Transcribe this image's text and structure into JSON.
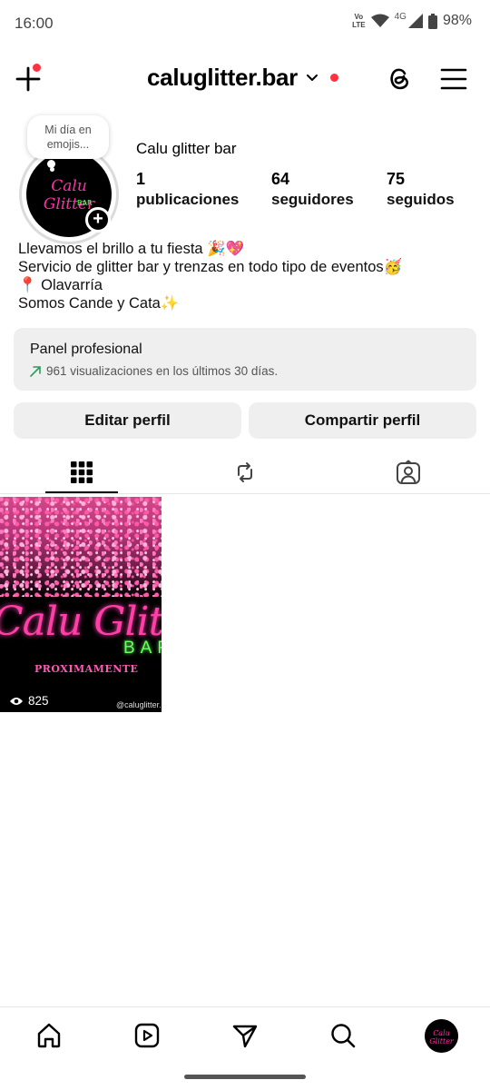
{
  "status_bar": {
    "time": "16:00",
    "volte_top": "Vo",
    "volte_bottom": "LTE",
    "network": "4G",
    "battery": "98%"
  },
  "header": {
    "username": "caluglitter.bar",
    "icons": [
      "plus-icon",
      "chevron-down-icon",
      "threads-icon",
      "menu-icon"
    ],
    "notification_color": "#ff3040"
  },
  "profile": {
    "note": "Mi día en emojis...",
    "avatar_logo_text": "Calu Glitter",
    "avatar_logo_sub": "BAR",
    "display_name": "Calu glitter bar",
    "stats": {
      "posts_count": "1",
      "posts_label": "publicaciones",
      "followers_count": "64",
      "followers_label": "seguidores",
      "following_count": "75",
      "following_label": "seguidos"
    },
    "bio": [
      "Llevamos el brillo a tu fiesta 🎉💖",
      "Servicio de glitter bar y trenzas en todo tipo de eventos🥳",
      "📍 Olavarría",
      "Somos Cande y Cata✨"
    ]
  },
  "panel": {
    "title": "Panel profesional",
    "subtitle": "961 visualizaciones en los últimos 30 días.",
    "accent": "#2e9b5e"
  },
  "buttons": {
    "edit": "Editar perfil",
    "share": "Compartir perfil"
  },
  "tabs": [
    "grid-icon",
    "reposts-icon",
    "tagged-icon"
  ],
  "post": {
    "title": "Calu Glitter",
    "bar": "BAR",
    "subtitle": "PROXIMAMENTE",
    "views": "825",
    "handle": "@caluglitter."
  },
  "bottom_nav": [
    "home-icon",
    "reels-icon",
    "direct-icon",
    "search-icon",
    "profile-avatar"
  ],
  "avatar_mini_text": "Calu Glitter"
}
